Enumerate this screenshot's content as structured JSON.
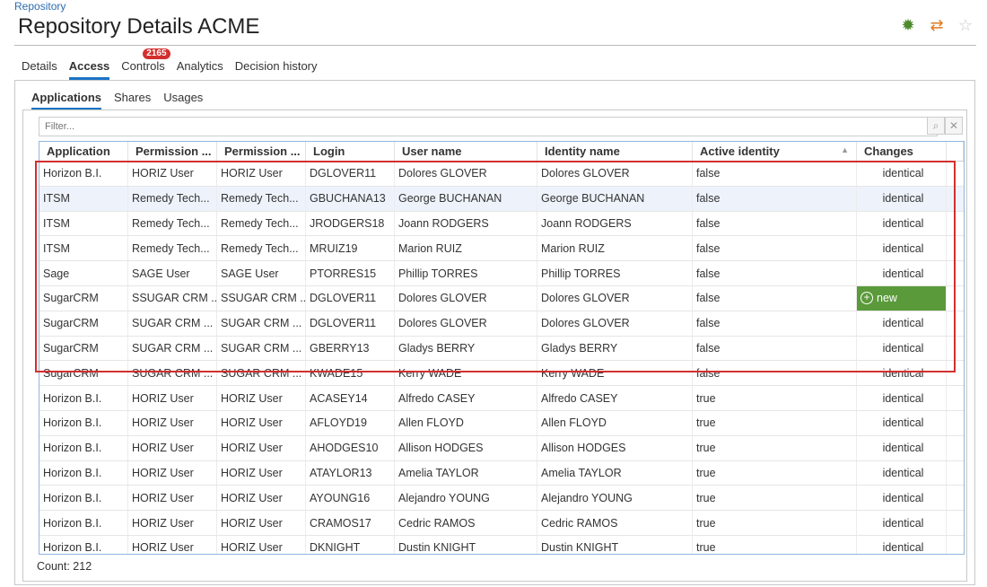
{
  "breadcrumb": "Repository",
  "page_title": "Repository Details ACME",
  "header_icons": [
    "bug-icon",
    "sync-icon",
    "star-icon"
  ],
  "tabs": [
    {
      "label": "Details"
    },
    {
      "label": "Access",
      "active": true
    },
    {
      "label": "Controls",
      "badge": "2165"
    },
    {
      "label": "Analytics"
    },
    {
      "label": "Decision history"
    }
  ],
  "subtabs": [
    {
      "label": "Applications",
      "active": true
    },
    {
      "label": "Shares"
    },
    {
      "label": "Usages"
    }
  ],
  "filter": {
    "placeholder": "Filter..."
  },
  "columns": [
    "Application",
    "Permission ...",
    "Permission ...",
    "Login",
    "User name",
    "Identity name",
    "Active identity",
    "Changes"
  ],
  "rows": [
    [
      "Horizon B.I.",
      "HORIZ User",
      "HORIZ User",
      "DGLOVER11",
      "Dolores GLOVER",
      "Dolores GLOVER",
      "false",
      "identical"
    ],
    [
      "ITSM",
      "Remedy Tech...",
      "Remedy Tech...",
      "GBUCHANA13",
      "George BUCHANAN",
      "George BUCHANAN",
      "false",
      "identical"
    ],
    [
      "ITSM",
      "Remedy Tech...",
      "Remedy Tech...",
      "JRODGERS18",
      "Joann RODGERS",
      "Joann RODGERS",
      "false",
      "identical"
    ],
    [
      "ITSM",
      "Remedy Tech...",
      "Remedy Tech...",
      "MRUIZ19",
      "Marion RUIZ",
      "Marion RUIZ",
      "false",
      "identical"
    ],
    [
      "Sage",
      "SAGE User",
      "SAGE User",
      "PTORRES15",
      "Phillip TORRES",
      "Phillip TORRES",
      "false",
      "identical"
    ],
    [
      "SugarCRM",
      "SSUGAR CRM ...",
      "SSUGAR CRM ...",
      "DGLOVER11",
      "Dolores GLOVER",
      "Dolores GLOVER",
      "false",
      "new"
    ],
    [
      "SugarCRM",
      "SUGAR CRM ...",
      "SUGAR CRM ...",
      "DGLOVER11",
      "Dolores GLOVER",
      "Dolores GLOVER",
      "false",
      "identical"
    ],
    [
      "SugarCRM",
      "SUGAR CRM ...",
      "SUGAR CRM ...",
      "GBERRY13",
      "Gladys BERRY",
      "Gladys BERRY",
      "false",
      "identical"
    ],
    [
      "SugarCRM",
      "SUGAR CRM ...",
      "SUGAR CRM ...",
      "KWADE15",
      "Kerry WADE",
      "Kerry WADE",
      "false",
      "identical"
    ],
    [
      "Horizon B.I.",
      "HORIZ User",
      "HORIZ User",
      "ACASEY14",
      "Alfredo CASEY",
      "Alfredo CASEY",
      "true",
      "identical"
    ],
    [
      "Horizon B.I.",
      "HORIZ User",
      "HORIZ User",
      "AFLOYD19",
      "Allen FLOYD",
      "Allen FLOYD",
      "true",
      "identical"
    ],
    [
      "Horizon B.I.",
      "HORIZ User",
      "HORIZ User",
      "AHODGES10",
      "Allison HODGES",
      "Allison HODGES",
      "true",
      "identical"
    ],
    [
      "Horizon B.I.",
      "HORIZ User",
      "HORIZ User",
      "ATAYLOR13",
      "Amelia TAYLOR",
      "Amelia TAYLOR",
      "true",
      "identical"
    ],
    [
      "Horizon B.I.",
      "HORIZ User",
      "HORIZ User",
      "AYOUNG16",
      "Alejandro YOUNG",
      "Alejandro YOUNG",
      "true",
      "identical"
    ],
    [
      "Horizon B.I.",
      "HORIZ User",
      "HORIZ User",
      "CRAMOS17",
      "Cedric RAMOS",
      "Cedric RAMOS",
      "true",
      "identical"
    ],
    [
      "Horizon B.I.",
      "HORIZ User",
      "HORIZ User",
      "DKNIGHT",
      "Dustin KNIGHT",
      "Dustin KNIGHT",
      "true",
      "identical"
    ]
  ],
  "selected_row": 1,
  "count_label": "Count: 212",
  "colors": {
    "accent": "#1a73c6",
    "new_badge": "#5a9a3a",
    "highlight": "#d32f2f"
  }
}
